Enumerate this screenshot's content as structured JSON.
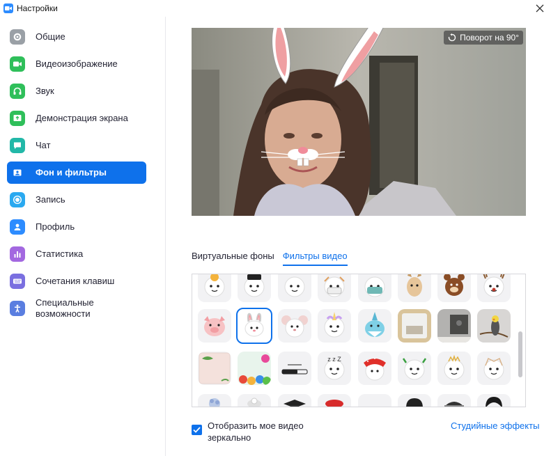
{
  "window": {
    "title": "Настройки"
  },
  "sidebar": {
    "items": [
      {
        "label": "Общие",
        "icon": "gear-icon",
        "color": "#9aa0a6",
        "active": false
      },
      {
        "label": "Видеоизображение",
        "icon": "video-camera-icon",
        "color": "#2fbf5a",
        "active": false
      },
      {
        "label": "Звук",
        "icon": "headphones-icon",
        "color": "#2fbf5a",
        "active": false
      },
      {
        "label": "Демонстрация экрана",
        "icon": "share-screen-icon",
        "color": "#2fbf5a",
        "active": false
      },
      {
        "label": "Чат",
        "icon": "chat-icon",
        "color": "#22b8a8",
        "active": false
      },
      {
        "label": "Фон и фильтры",
        "icon": "background-icon",
        "color": "#0e71eb",
        "active": true
      },
      {
        "label": "Запись",
        "icon": "record-icon",
        "color": "#2aa9f0",
        "active": false
      },
      {
        "label": "Профиль",
        "icon": "profile-icon",
        "color": "#2d8cff",
        "active": false
      },
      {
        "label": "Статистика",
        "icon": "statistics-icon",
        "color": "#a368e0",
        "active": false
      },
      {
        "label": "Сочетания клавиш",
        "icon": "keyboard-icon",
        "color": "#7a6fe0",
        "active": false
      },
      {
        "label": "Специальные возможности",
        "icon": "accessibility-icon",
        "color": "#5a7ee0",
        "active": false
      }
    ]
  },
  "preview": {
    "rotate_label": "Поворот на 90°"
  },
  "tabs": [
    {
      "label": "Виртуальные фоны",
      "active": false
    },
    {
      "label": "Фильтры видео",
      "active": true
    }
  ],
  "filters": {
    "rows": [
      [
        "face-glasses",
        "face-hat",
        "face-plain",
        "face-mask-white",
        "face-mask-blue",
        "llama",
        "bear",
        "reindeer"
      ],
      [
        "pig",
        "bunny",
        "mouse",
        "unicorn",
        "shark",
        "mirror-frame",
        "tv-frame",
        "bird"
      ],
      [
        "leaf-frame",
        "candy-frame",
        "loading-bar",
        "sleepy-face",
        "red-bandana",
        "sprout-face",
        "crown-face",
        "beard-face"
      ],
      [
        "flower",
        "hat-white",
        "graduation-cap",
        "beret",
        "none",
        "hair-dark",
        "helmet",
        "hair-black"
      ]
    ],
    "selected": "bunny"
  },
  "mirror": {
    "label": "Отобразить мое видео зеркально",
    "checked": true
  },
  "studio_effects_label": "Студийные эффекты"
}
